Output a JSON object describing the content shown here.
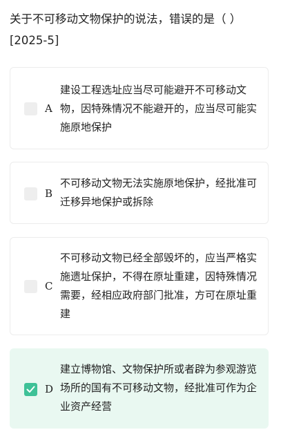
{
  "question": {
    "stem": "关于不可移动文物保护的说法，错误的是（ ）",
    "source": "[2025-5]"
  },
  "options": [
    {
      "letter": "A",
      "text": "建设工程选址应当尽可能避开不可移动文物，因特殊情况不能避开的，应当尽可能实施原地保护",
      "checked": false
    },
    {
      "letter": "B",
      "text": "不可移动文物无法实施原地保护，经批准可迁移异地保护或拆除",
      "checked": false
    },
    {
      "letter": "C",
      "text": "不可移动文物已经全部毁坏的，应当严格实施遗址保护，不得在原址重建，因特殊情况需要，经相应政府部门批准，方可在原址重建",
      "checked": false
    },
    {
      "letter": "D",
      "text": "建立博物馆、文物保护所或者辟为参观游览场所的国有不可移动文物，经批准可作为企业资产经营",
      "checked": true
    }
  ],
  "colors": {
    "selected_bg": "#e9f8f1",
    "checkbox_checked": "#3ec197",
    "checkbox_unchecked": "#eeeeee"
  }
}
